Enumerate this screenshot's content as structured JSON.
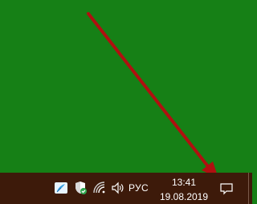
{
  "taskbar": {
    "language": "РУС",
    "time": "13:41",
    "date": "19.08.2019"
  },
  "icons": {
    "app": "feather-app-icon",
    "defender": "windows-defender-shield-icon",
    "network": "wifi-icon",
    "volume": "speaker-icon",
    "notifications": "action-center-icon"
  },
  "colors": {
    "desktop": "#168016",
    "taskbar": "#3d1a0a",
    "arrow": "#b01010",
    "shield_check": "#2fa84f"
  }
}
